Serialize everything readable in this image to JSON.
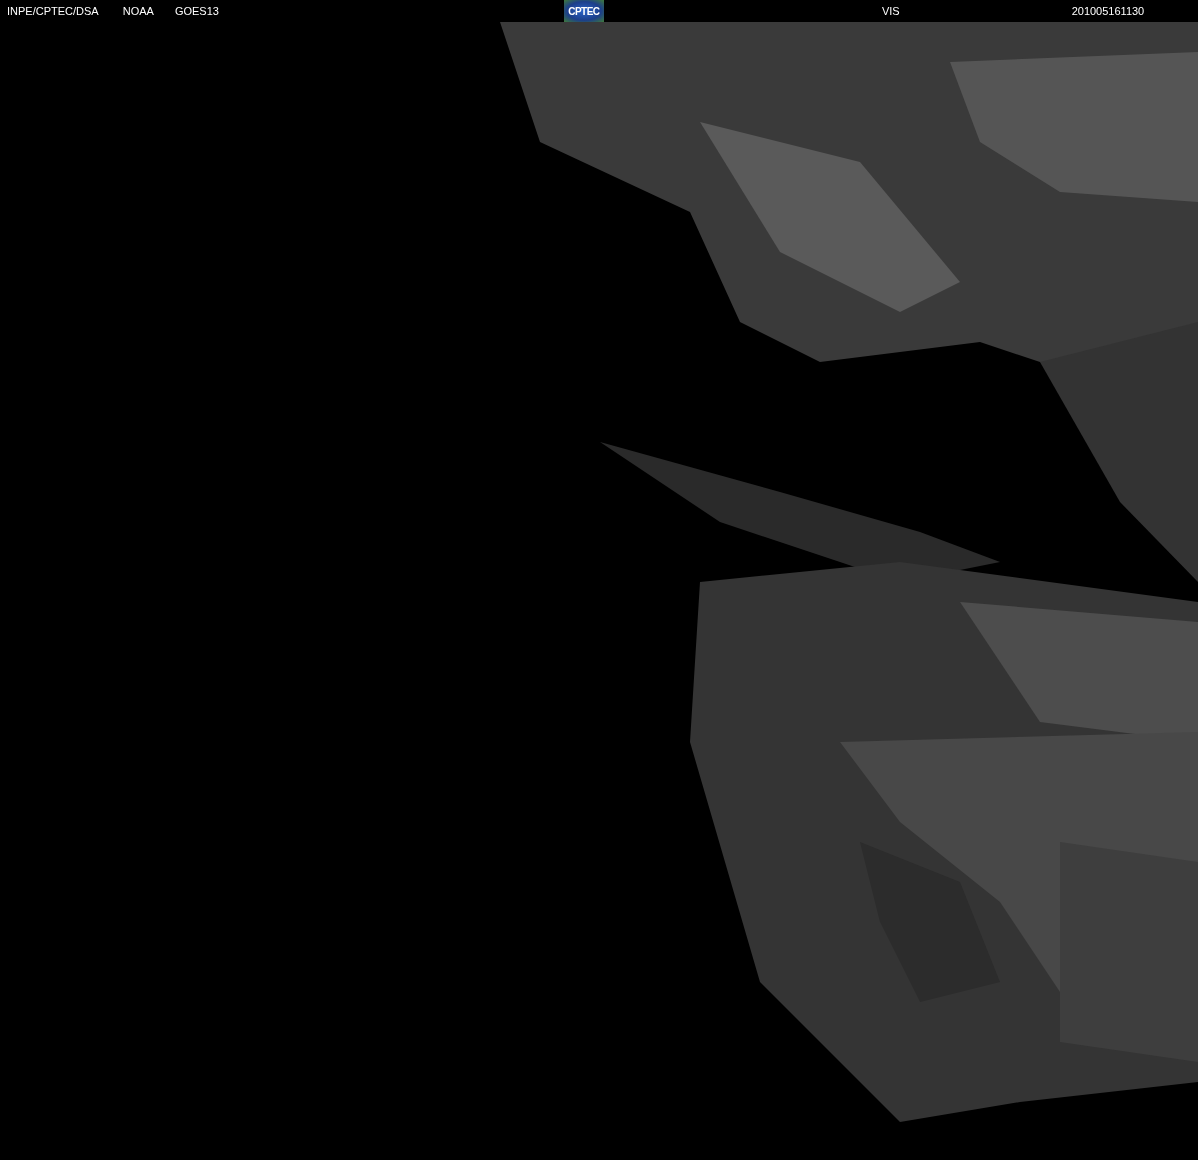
{
  "header": {
    "source": "INPE/CPTEC/DSA",
    "agency": "NOAA",
    "satellite": "GOES13",
    "logo": "CPTEC",
    "channel": "VIS",
    "timestamp": "201005161130"
  }
}
